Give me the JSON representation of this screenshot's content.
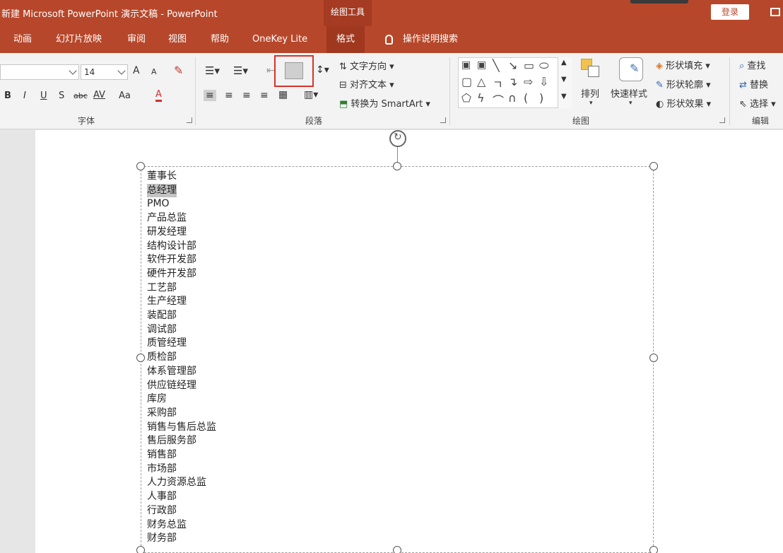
{
  "titlebar": {
    "title": "新建 Microsoft PowerPoint 演示文稿 - PowerPoint",
    "drawing_tools": "绘图工具",
    "login": "登录"
  },
  "tabs": [
    {
      "label": "动画",
      "active": false
    },
    {
      "label": "幻灯片放映",
      "active": false
    },
    {
      "label": "审阅",
      "active": false
    },
    {
      "label": "视图",
      "active": false
    },
    {
      "label": "帮助",
      "active": false
    },
    {
      "label": "OneKey Lite",
      "active": false
    },
    {
      "label": "格式",
      "active": true
    }
  ],
  "tell_me": "操作说明搜索",
  "ribbon": {
    "font": {
      "group_label": "字体",
      "font_name": "",
      "font_size": "14",
      "grow": "A",
      "shrink": "A",
      "bold": "B",
      "italic": "I",
      "underline": "U",
      "shadow": "S",
      "strike": "abc",
      "spacing": "AV",
      "case": "Aa",
      "color": "A"
    },
    "paragraph": {
      "group_label": "段落",
      "text_direction": "文字方向",
      "align_text": "对齐文本",
      "smartart": "转换为 SmartArt"
    },
    "drawing": {
      "group_label": "绘图",
      "arrange": "排列",
      "quick_styles": "快速样式",
      "shape_fill": "形状填充",
      "shape_outline": "形状轮廓",
      "shape_effects": "形状效果"
    },
    "editing": {
      "group_label": "编辑",
      "find": "查找",
      "replace": "替换",
      "select": "选择"
    }
  },
  "slide_text": [
    "董事长",
    "总经理",
    "PMO",
    "产品总监",
    "研发经理",
    "结构设计部",
    "软件开发部",
    "硬件开发部",
    "工艺部",
    "生产经理",
    "装配部",
    "调试部",
    "质管经理",
    "质检部",
    "体系管理部",
    "供应链经理",
    "库房",
    "采购部",
    "销售与售后总监",
    "售后服务部",
    "销售部",
    "市场部",
    "人力资源总监",
    "人事部",
    "行政部",
    "财务总监",
    "财务部"
  ],
  "selected_item": "总经理",
  "colors": {
    "accent": "#b7472a",
    "highlight_border": "#d9322b",
    "font_color": "#d32f2f"
  }
}
